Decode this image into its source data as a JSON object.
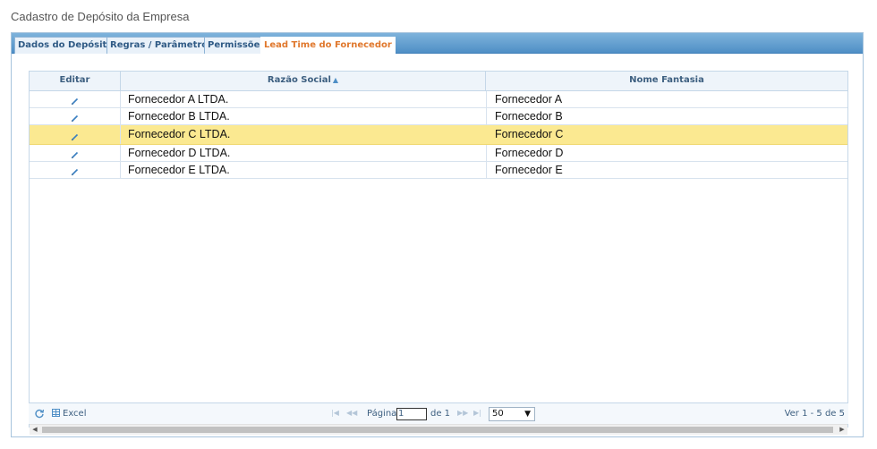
{
  "page": {
    "title": "Cadastro de Depósito da Empresa"
  },
  "tabs": [
    {
      "label": "Dados do Depósito"
    },
    {
      "label": "Regras / Parâmetros"
    },
    {
      "label": "Permissões"
    },
    {
      "label": "Lead Time do Fornecedor"
    }
  ],
  "grid": {
    "columns": {
      "edit": "Editar",
      "razao": "Razão Social",
      "fantasia": "Nome Fantasia"
    },
    "rows": [
      {
        "razao": "Fornecedor A LTDA.",
        "fantasia": "Fornecedor A"
      },
      {
        "razao": "Fornecedor B LTDA.",
        "fantasia": "Fornecedor B"
      },
      {
        "razao": "Fornecedor C LTDA.",
        "fantasia": "Fornecedor C"
      },
      {
        "razao": "Fornecedor D LTDA.",
        "fantasia": "Fornecedor D"
      },
      {
        "razao": "Fornecedor E LTDA.",
        "fantasia": "Fornecedor E"
      }
    ]
  },
  "pager": {
    "excel_label": "Excel",
    "page_label": "Página",
    "page_value": "1",
    "of_label": "de 1",
    "page_size": "50",
    "view_count": "Ver 1 - 5 de 5"
  },
  "colors": {
    "tab_active_text": "#e0782d",
    "selected_row": "#fbe991",
    "tabbar": "#4f8fc6"
  },
  "icons": [
    "pencil-icon",
    "sort-asc-icon",
    "refresh-icon",
    "excel-icon",
    "first-page-icon",
    "prev-page-icon",
    "next-page-icon",
    "last-page-icon"
  ]
}
